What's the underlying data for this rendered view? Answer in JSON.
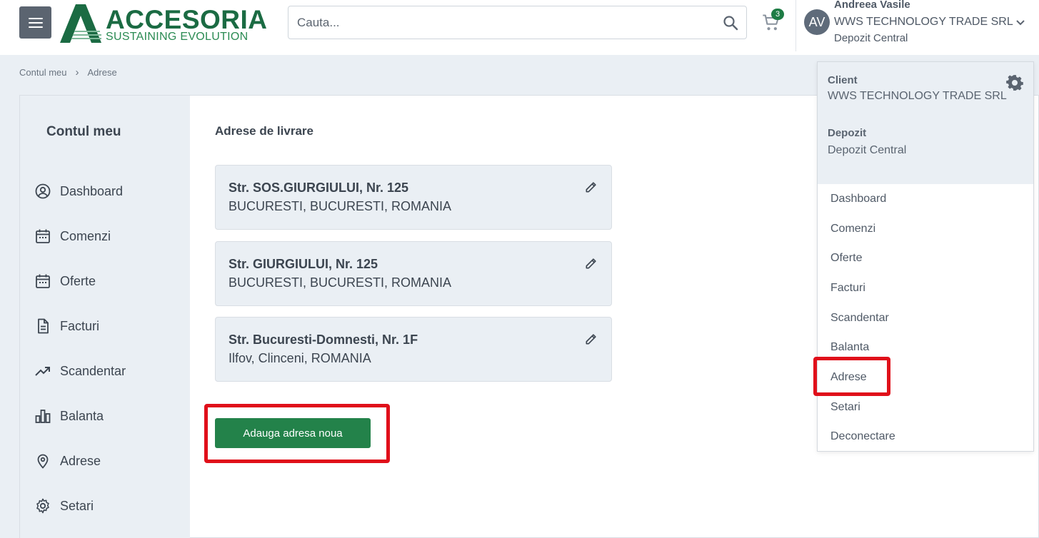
{
  "header": {
    "logo_title": "ACCESORIA",
    "logo_tagline": "SUSTAINING EVOLUTION",
    "search_placeholder": "Cauta...",
    "cart_count": "3",
    "user": {
      "initials": "AV",
      "name": "Andreea Vasile",
      "company": "WWS TECHNOLOGY TRADE SRL",
      "depot": "Depozit Central"
    }
  },
  "breadcrumb": {
    "items": [
      "Contul meu",
      "Adrese"
    ]
  },
  "sidebar": {
    "title": "Contul meu",
    "items": [
      {
        "label": "Dashboard",
        "icon": "account-circle-icon"
      },
      {
        "label": "Comenzi",
        "icon": "calendar-icon"
      },
      {
        "label": "Oferte",
        "icon": "calendar-icon"
      },
      {
        "label": "Facturi",
        "icon": "document-icon"
      },
      {
        "label": "Scandentar",
        "icon": "trending-up-icon"
      },
      {
        "label": "Balanta",
        "icon": "bar-chart-icon"
      },
      {
        "label": "Adrese",
        "icon": "location-pin-icon"
      },
      {
        "label": "Setari",
        "icon": "gear-icon"
      }
    ]
  },
  "main": {
    "title": "Adrese de livrare",
    "addresses": [
      {
        "street": "Str. SOS.GIURGIULUI, Nr. 125",
        "city": "BUCURESTI, BUCURESTI, ROMANIA"
      },
      {
        "street": "Str. GIURGIULUI, Nr. 125",
        "city": "BUCURESTI, BUCURESTI, ROMANIA"
      },
      {
        "street": "Str. Bucuresti-Domnesti, Nr. 1F",
        "city": "Ilfov, Clinceni, ROMANIA"
      }
    ],
    "add_button": "Adauga adresa noua"
  },
  "user_menu": {
    "client_label": "Client",
    "client_value": "WWS TECHNOLOGY TRADE SRL",
    "depot_label": "Depozit",
    "depot_value": "Depozit Central",
    "items": [
      "Dashboard",
      "Comenzi",
      "Oferte",
      "Facturi",
      "Scandentar",
      "Balanta",
      "Adrese",
      "Setari",
      "Deconectare"
    ]
  },
  "colors": {
    "brand_green": "#1b6b43",
    "button_green": "#23824a",
    "highlight_red": "#e00f1a"
  }
}
